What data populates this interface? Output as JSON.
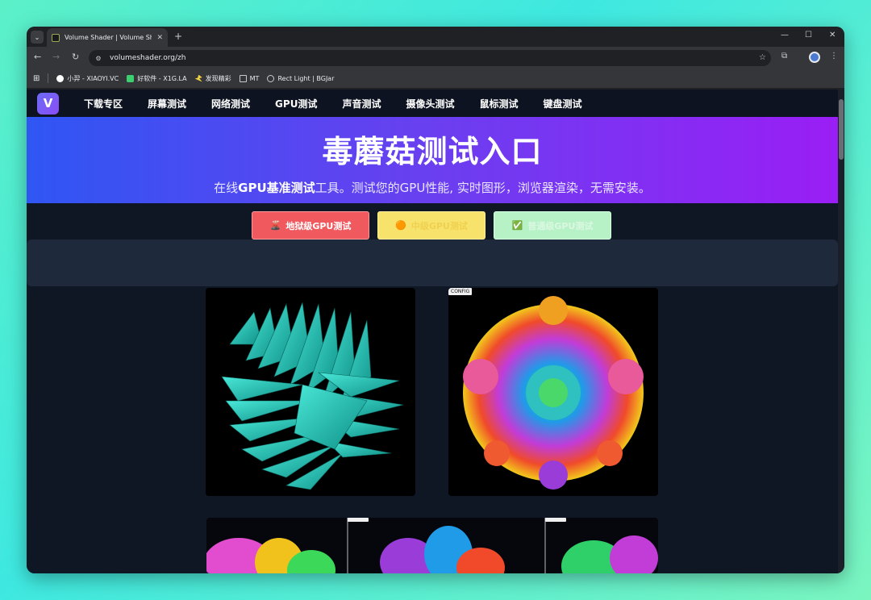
{
  "browser": {
    "tab_title": "Volume Shader | Volume Sha",
    "tab_close": "✕",
    "new_tab": "+",
    "url": "volumeshader.org/zh",
    "window_controls": {
      "minimize": "—",
      "maximize": "☐",
      "close": "✕"
    },
    "bookmarks": [
      {
        "label": "小羿 - XIAOYI.VC",
        "icon": "github-icon",
        "color": "#ffffff"
      },
      {
        "label": "好软件 - X1G.LA",
        "icon": "green-square-icon",
        "color": "#3ccf70"
      },
      {
        "label": "发现精彩",
        "icon": "bolt-icon",
        "color": "#f5d442"
      },
      {
        "label": "MT",
        "icon": "folder-icon",
        "color": "#c8cacd"
      },
      {
        "label": "Rect Light | BGJar",
        "icon": "globe-icon",
        "color": "#c8cacd"
      }
    ]
  },
  "site": {
    "logo_letter": "V",
    "nav": [
      "下载专区",
      "屏幕测试",
      "网络测试",
      "GPU测试",
      "声音测试",
      "摄像头测试",
      "鼠标测试",
      "键盘测试"
    ],
    "hero_title": "毒蘑菇测试入口",
    "hero_sub_prefix": "在线",
    "hero_sub_bold": "GPU基准测试",
    "hero_sub_suffix": "工具。测试您的GPU性能, 实时图形，浏览器渲染，无需安装。",
    "buttons": {
      "hell": {
        "icon": "🌋",
        "label": "地狱级GPU测试"
      },
      "mid": {
        "icon": "🟠",
        "label": "中级GPU测试"
      },
      "low": {
        "icon": "✅",
        "label": "普通级GPU测试"
      }
    },
    "config_label": "CONFIG"
  },
  "colors": {
    "hero_left": "#2f56f3",
    "hero_right": "#9a1ef5",
    "btn_hell": "#f05a5f",
    "btn_mid": "#f7e36b",
    "btn_low": "#b6f2c6"
  }
}
